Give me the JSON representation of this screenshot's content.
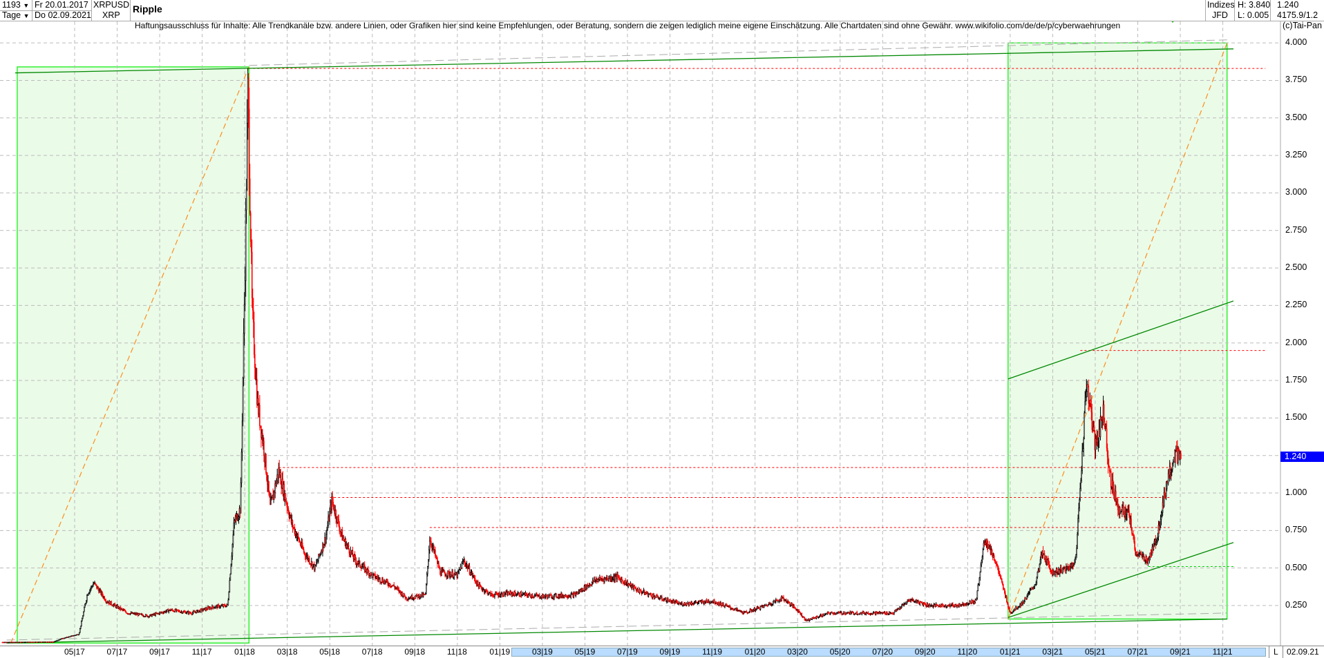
{
  "header": {
    "bar_count": "1193",
    "start_date": "Fr 20.01.2017",
    "period": "Tage",
    "end_date": "Do 02.09.2021",
    "symbol": "XRPUSD",
    "short": "XRP",
    "name": "Ripple",
    "source_top": "Indizes",
    "source_bottom": "JFD",
    "high": "H: 3.840",
    "low": "L: 0.005",
    "last": "1.240",
    "extra": "4175.9/1.2"
  },
  "disclaimer": "Haftungsausschluss für Inhalte: Alle Trendkanäle bzw. andere Linien, oder Grafiken hier sind keine Empfehlungen, oder Beratung, sondern die zeigen lediglich meine eigene Einschätzung. Alle Chartdaten sind ohne Gewähr.  www.wikifolio.com/de/de/p/cyberwaehrungen",
  "copyright": "(c)Tai-Pan",
  "axis_mode": "L",
  "axis_date": "02.09.21",
  "colors": {
    "up": "#000000",
    "down": "#ff0000",
    "box": "#00ee00",
    "boxfill": "#eafbe8",
    "channel": "#008800",
    "orange": "#ff8c1a",
    "level": "#ff0000",
    "current": "#0000ff"
  },
  "chart_data": {
    "type": "candlestick",
    "title": "Ripple",
    "xlabel": "",
    "ylabel": "",
    "x_unit": "months since 01.2017",
    "ylim": [
      0,
      4.1
    ],
    "yticks": [
      "4.000",
      "3.750",
      "3.500",
      "3.250",
      "3.000",
      "2.750",
      "2.500",
      "2.250",
      "2.000",
      "1.750",
      "1.500",
      "1.250",
      "1.000",
      "0.750",
      "0.500",
      "0.250"
    ],
    "ytick_values": [
      4,
      3.75,
      3.5,
      3.25,
      3,
      2.75,
      2.5,
      2.25,
      2,
      1.75,
      1.5,
      1.25,
      1,
      0.75,
      0.5,
      0.25
    ],
    "xticks": [
      "05|17",
      "07|17",
      "09|17",
      "11|17",
      "01|18",
      "03|18",
      "05|18",
      "07|18",
      "09|18",
      "11|18",
      "01|19",
      "03|19",
      "05|19",
      "07|19",
      "09|19",
      "11|19",
      "01|20",
      "03|20",
      "05|20",
      "07|20",
      "09|20",
      "11|20",
      "01|21",
      "03|21",
      "05|21",
      "07|21",
      "09|21",
      "11|21"
    ],
    "xtick_months": [
      4,
      6,
      8,
      10,
      12,
      14,
      16,
      18,
      20,
      22,
      24,
      26,
      28,
      30,
      32,
      34,
      36,
      38,
      40,
      42,
      44,
      46,
      48,
      50,
      52,
      54,
      56,
      58
    ],
    "current_value": "1.240",
    "current_price": 1.24,
    "price_keypoints": [
      [
        0.6,
        0.006
      ],
      [
        3.0,
        0.008
      ],
      [
        3.4,
        0.03
      ],
      [
        4.2,
        0.06
      ],
      [
        4.6,
        0.33
      ],
      [
        4.9,
        0.4
      ],
      [
        5.5,
        0.28
      ],
      [
        6.5,
        0.2
      ],
      [
        7.5,
        0.18
      ],
      [
        8.5,
        0.22
      ],
      [
        9.5,
        0.2
      ],
      [
        10.5,
        0.24
      ],
      [
        11.2,
        0.25
      ],
      [
        11.5,
        0.8
      ],
      [
        11.8,
        0.9
      ],
      [
        12.0,
        2.4
      ],
      [
        12.15,
        3.7
      ],
      [
        12.35,
        2.2
      ],
      [
        12.6,
        1.6
      ],
      [
        12.9,
        1.3
      ],
      [
        13.2,
        0.9
      ],
      [
        13.6,
        1.15
      ],
      [
        14.2,
        0.8
      ],
      [
        14.8,
        0.6
      ],
      [
        15.3,
        0.5
      ],
      [
        15.8,
        0.7
      ],
      [
        16.1,
        0.95
      ],
      [
        16.6,
        0.7
      ],
      [
        17.2,
        0.55
      ],
      [
        18.0,
        0.45
      ],
      [
        19.0,
        0.38
      ],
      [
        19.6,
        0.3
      ],
      [
        20.5,
        0.32
      ],
      [
        20.7,
        0.7
      ],
      [
        21.2,
        0.47
      ],
      [
        22.0,
        0.45
      ],
      [
        22.3,
        0.55
      ],
      [
        23.0,
        0.38
      ],
      [
        23.6,
        0.32
      ],
      [
        24.5,
        0.33
      ],
      [
        26,
        0.31
      ],
      [
        27.5,
        0.32
      ],
      [
        28.5,
        0.42
      ],
      [
        29.5,
        0.44
      ],
      [
        30.5,
        0.35
      ],
      [
        31.5,
        0.3
      ],
      [
        32.5,
        0.26
      ],
      [
        34,
        0.28
      ],
      [
        35.5,
        0.2
      ],
      [
        36.5,
        0.25
      ],
      [
        37.3,
        0.3
      ],
      [
        38.0,
        0.22
      ],
      [
        38.4,
        0.15
      ],
      [
        39.5,
        0.2
      ],
      [
        41,
        0.2
      ],
      [
        42.5,
        0.2
      ],
      [
        43.3,
        0.29
      ],
      [
        44.2,
        0.25
      ],
      [
        45.5,
        0.25
      ],
      [
        46.4,
        0.28
      ],
      [
        46.8,
        0.7
      ],
      [
        47.3,
        0.55
      ],
      [
        47.8,
        0.3
      ],
      [
        48.0,
        0.2
      ],
      [
        48.6,
        0.27
      ],
      [
        49.2,
        0.4
      ],
      [
        49.5,
        0.6
      ],
      [
        50.0,
        0.47
      ],
      [
        50.8,
        0.5
      ],
      [
        51.1,
        0.57
      ],
      [
        51.25,
        0.95
      ],
      [
        51.6,
        1.75
      ],
      [
        52.0,
        1.3
      ],
      [
        52.4,
        1.55
      ],
      [
        52.7,
        1.1
      ],
      [
        53.1,
        0.9
      ],
      [
        53.6,
        0.85
      ],
      [
        53.9,
        0.6
      ],
      [
        54.5,
        0.55
      ],
      [
        54.9,
        0.7
      ],
      [
        55.4,
        1.1
      ],
      [
        55.7,
        1.25
      ],
      [
        56.05,
        1.24
      ]
    ]
  },
  "overlays": {
    "boxes": [
      {
        "m0": 1.3,
        "m1": 12.2,
        "p0": 0,
        "p1": 3.84
      },
      {
        "m0": 47.9,
        "m1": 58.2,
        "p0": 0.16,
        "p1": 4.0
      }
    ],
    "diagonals": [
      {
        "m0": 1.0,
        "p0": 0,
        "m1": 12.2,
        "p1": 3.84
      },
      {
        "m0": 47.9,
        "p0": 0.16,
        "m1": 58.2,
        "p1": 4.0
      }
    ],
    "channels": [
      {
        "m0": 1.2,
        "p0": 3.8,
        "m1": 58.5,
        "p1": 3.96
      },
      {
        "m0": 0.8,
        "p0": 0.0,
        "m1": 58.2,
        "p1": 0.16
      },
      {
        "m0": 47.9,
        "p0": 1.76,
        "m1": 58.5,
        "p1": 2.28
      },
      {
        "m0": 47.9,
        "p0": 0.17,
        "m1": 58.5,
        "p1": 0.67
      }
    ],
    "levels": [
      {
        "m0": 12.2,
        "m1": 60,
        "p": 3.83,
        "c": "red"
      },
      {
        "m0": 51.3,
        "m1": 60,
        "p": 1.95,
        "c": "red"
      },
      {
        "m0": 13.6,
        "m1": 55.5,
        "p": 1.17,
        "c": "red"
      },
      {
        "m0": 16,
        "m1": 55.5,
        "p": 0.97,
        "c": "red"
      },
      {
        "m0": 20.7,
        "m1": 55.5,
        "p": 0.77,
        "c": "red"
      },
      {
        "m0": 54.5,
        "m1": 58.5,
        "p": 0.51,
        "c": "green"
      }
    ]
  }
}
